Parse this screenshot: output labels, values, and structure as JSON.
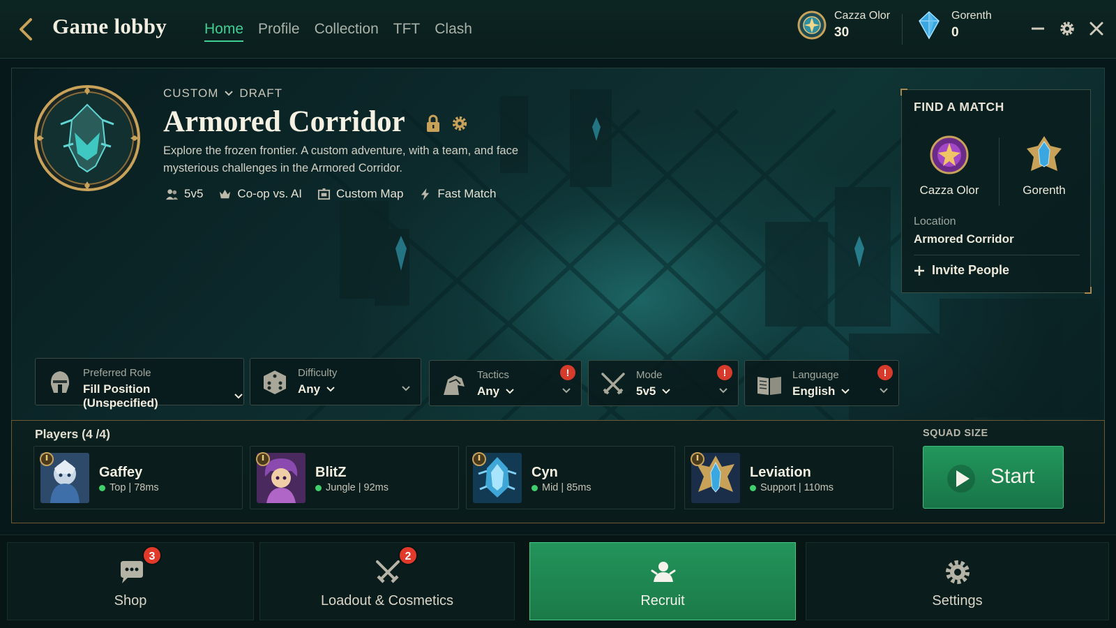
{
  "header": {
    "title": "Game lobby",
    "nav": [
      {
        "label": "Home",
        "active": true
      },
      {
        "label": "Profile",
        "active": false
      },
      {
        "label": "Collection",
        "active": false
      },
      {
        "label": "TFT",
        "active": false
      },
      {
        "label": "Clash",
        "active": false
      }
    ],
    "currencies": [
      {
        "name": "Cazza Olor",
        "value": "30",
        "icon": "gold-emblem-icon"
      },
      {
        "name": "Gorenth",
        "value": "0",
        "icon": "blue-crystal-icon"
      }
    ]
  },
  "hero": {
    "crumb_primary": "CUSTOM",
    "crumb_secondary": "DRAFT",
    "title": "Armored Corridor",
    "description": "Explore the frozen frontier. A custom adventure, with a team, and face mysterious challenges in the Armored Corridor.",
    "tags": [
      {
        "label": "5v5",
        "icon": "people-icon"
      },
      {
        "label": "Co-op vs. AI",
        "icon": "crown-icon"
      },
      {
        "label": "Custom Map",
        "icon": "map-icon"
      },
      {
        "label": "Fast Match",
        "icon": "lightning-icon"
      }
    ]
  },
  "find_match": {
    "title": "FIND A MATCH",
    "players": [
      {
        "name": "Cazza Olor"
      },
      {
        "name": "Gorenth"
      }
    ],
    "location_label": "Location",
    "location_value": "Armored Corridor",
    "invite_label": "Invite People"
  },
  "filters": [
    {
      "label": "Preferred Role",
      "value": "Fill Position (Unspecified)",
      "icon": "helmet-icon",
      "alert": false
    },
    {
      "label": "Difficulty",
      "value": "Any",
      "icon": "dice-icon",
      "alert": false
    },
    {
      "label": "Tactics",
      "value": "Any",
      "icon": "tactics-icon",
      "alert": true
    },
    {
      "label": "Mode",
      "value": "5v5",
      "icon": "crossed-swords-icon",
      "alert": true
    },
    {
      "label": "Language",
      "value": "English",
      "icon": "book-icon",
      "alert": true
    }
  ],
  "alert_glyph": "!",
  "players": {
    "title": "Players (4 /4)",
    "list": [
      {
        "name": "Gaffey",
        "info": "Top | 78ms"
      },
      {
        "name": "BlitZ",
        "info": "Jungle | 92ms"
      },
      {
        "name": "Cyn",
        "info": "Mid | 85ms"
      },
      {
        "name": "Leviation",
        "info": "Support | 110ms"
      }
    ],
    "squad_label": "SQUAD SIZE",
    "start_label": "Start"
  },
  "bottom_nav": [
    {
      "label": "Shop",
      "badge": "3",
      "icon": "chat-bubble-icon",
      "active": false
    },
    {
      "label": "Loadout & Cosmetics",
      "badge": "2",
      "icon": "crossed-swords-icon",
      "active": false
    },
    {
      "label": "Recruit",
      "badge": "",
      "icon": "recruit-icon",
      "active": true
    },
    {
      "label": "Settings",
      "badge": "",
      "icon": "gear-icon",
      "active": false
    }
  ],
  "colors": {
    "accent_green": "#3fcf93",
    "start_green": "#22975c",
    "alert_red": "#d73b2c",
    "gold_border": "#c9a25a",
    "background": "#07181a"
  }
}
